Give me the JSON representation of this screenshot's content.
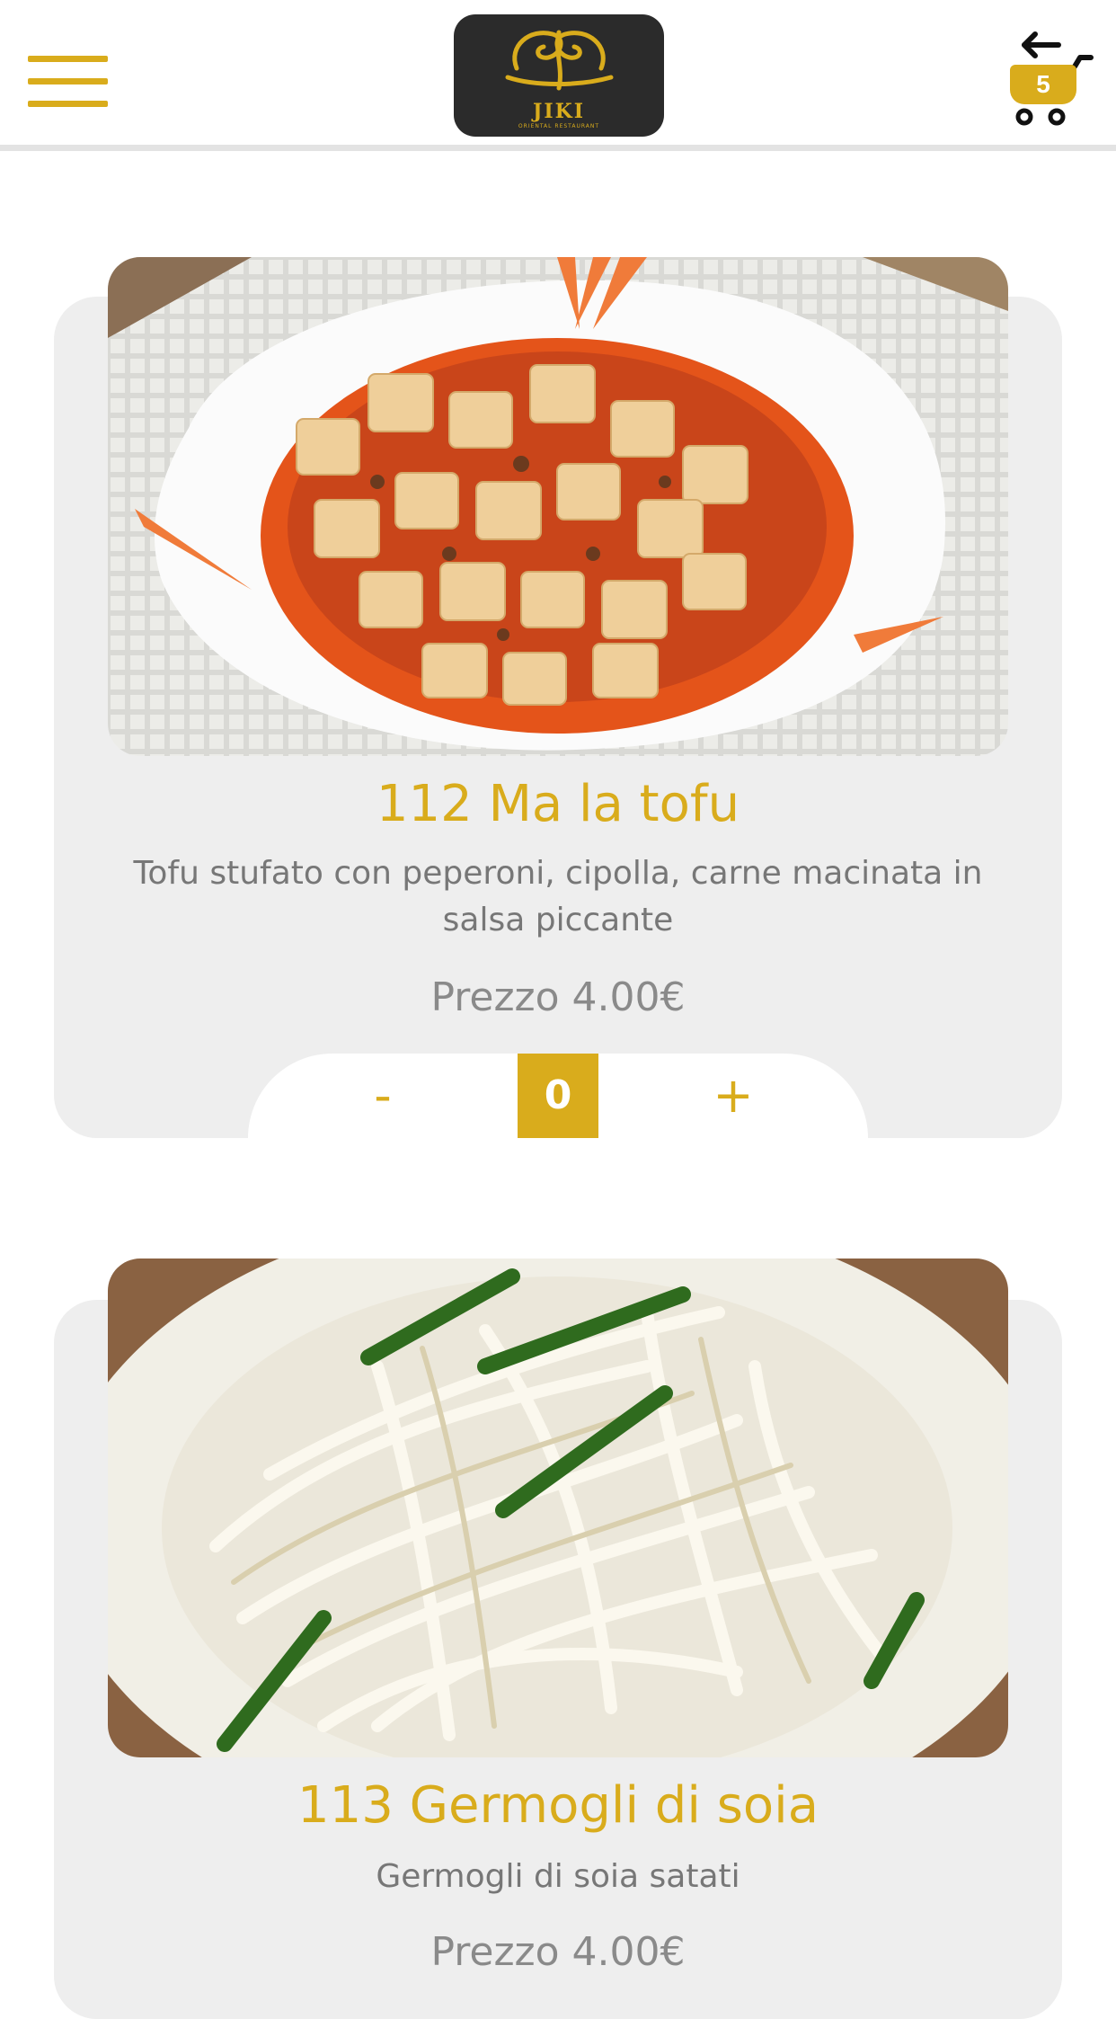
{
  "header": {
    "logo": {
      "name": "JIKI",
      "tagline": "ORIENTAL RESTAURANT"
    },
    "cart": {
      "count": "5"
    }
  },
  "products": [
    {
      "title": "112 Ma la tofu",
      "description": "Tofu stufato con peperoni, cipolla, carne macinata in salsa piccante",
      "price": "Prezzo 4.00€",
      "quantity": "0",
      "minus_label": "-",
      "plus_label": "+"
    },
    {
      "title": "113 Germogli di soia",
      "description": "Germogli di soia satati",
      "price": "Prezzo 4.00€"
    }
  ],
  "colors": {
    "accent": "#d9ac1c",
    "card_bg": "#eeeeee",
    "text_gray": "#777777"
  },
  "icons": [
    "menu-icon",
    "cart-icon",
    "back-arrow-icon",
    "dragon-logo-icon"
  ]
}
